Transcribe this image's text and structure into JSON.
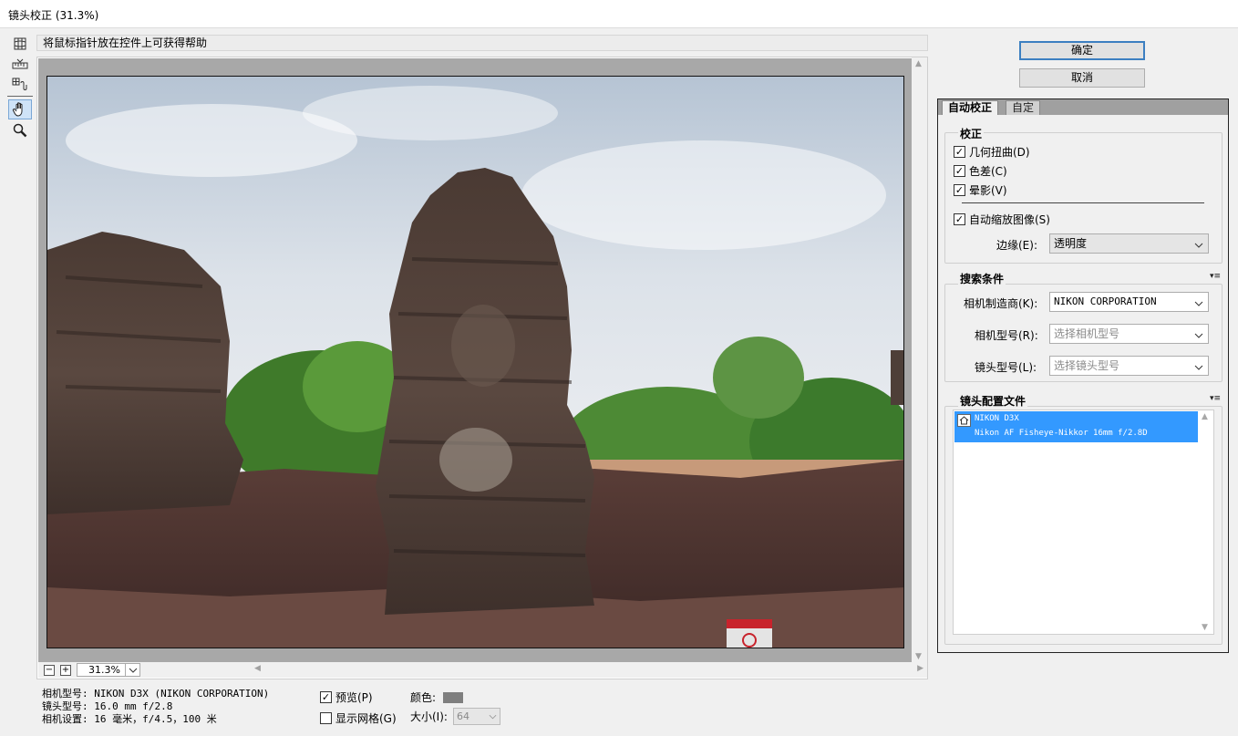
{
  "window": {
    "title": "镜头校正 (31.3%)"
  },
  "help": {
    "text": "将鼠标指针放在控件上可获得帮助"
  },
  "zoom": {
    "minus": "−",
    "plus": "+",
    "value": "31.3%"
  },
  "camera_info": {
    "model": "相机型号: NIKON D3X (NIKON CORPORATION)",
    "lens": "镜头型号: 16.0 mm f/2.8",
    "settings": "相机设置: 16 毫米，f/4.5，100 米"
  },
  "options": {
    "preview_label": "预览(P)",
    "grid_label": "显示网格(G)",
    "color_label": "颜色:",
    "color_value": "#7f7f7f",
    "size_label": "大小(I):",
    "size_value": "64"
  },
  "buttons": {
    "ok": "确定",
    "cancel": "取消"
  },
  "tabs": {
    "auto": "自动校正",
    "custom": "自定"
  },
  "correction": {
    "title": "校正",
    "geometric": "几何扭曲(D)",
    "chromatic": "色差(C)",
    "vignette": "晕影(V)",
    "autoscale": "自动缩放图像(S)",
    "edge_label": "边缘(E):",
    "edge_value": "透明度"
  },
  "search": {
    "title": "搜索条件",
    "make_label": "相机制造商(K):",
    "make_value": "NIKON CORPORATION",
    "model_label": "相机型号(R):",
    "model_placeholder": "选择相机型号",
    "lens_label": "镜头型号(L):",
    "lens_placeholder": "选择镜头型号"
  },
  "profiles": {
    "title": "镜头配置文件",
    "items": [
      {
        "camera": "NIKON D3X",
        "lens": "Nikon AF Fisheye-Nikkor 16mm f/2.8D"
      }
    ]
  },
  "icons": {
    "tools": [
      "distortion-tool-icon",
      "straighten-tool-icon",
      "move-grid-icon",
      "hand-icon",
      "zoom-icon"
    ]
  },
  "colors": {
    "accent": "#3399ff",
    "button_border": "#3c7fc1"
  }
}
